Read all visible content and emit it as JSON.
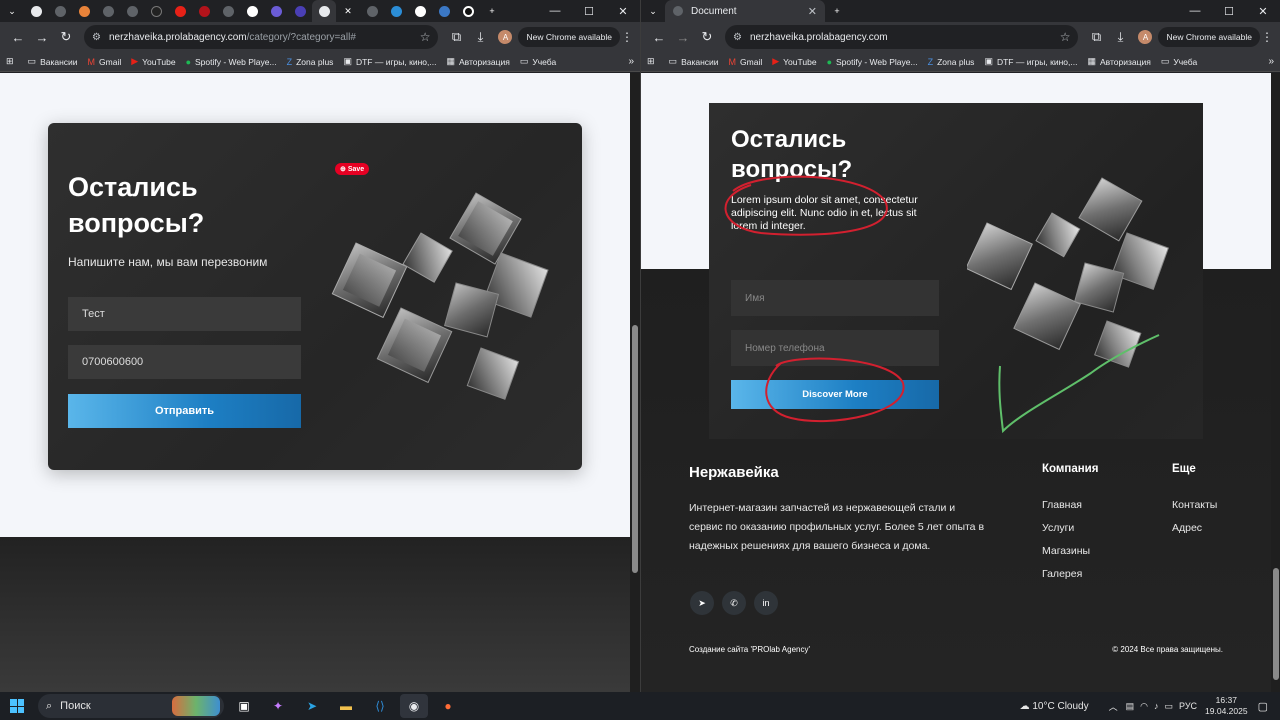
{
  "left_window": {
    "url_host": "nerzhaveika.prolabagency.com",
    "url_path": "/category/?category=all#",
    "new_chrome": "New Chrome available",
    "bookmarks": [
      "Вакансии",
      "Gmail",
      "YouTube",
      "Spotify - Web Playe...",
      "Zona plus",
      "DTF — игры, кино,...",
      "Авторизация",
      "Учеба"
    ],
    "form": {
      "title_line1": "Остались",
      "title_line2": "вопросы?",
      "subtitle": "Напишите нам, мы вам перезвоним",
      "name_value": "Тест",
      "phone_value": "0700600600",
      "submit_label": "Отправить",
      "pin_save": "Save"
    }
  },
  "right_window": {
    "tab_title": "Document",
    "url_host": "nerzhaveika.prolabagency.com",
    "new_chrome": "New Chrome available",
    "bookmarks": [
      "Вакансии",
      "Gmail",
      "YouTube",
      "Spotify - Web Playe...",
      "Zona plus",
      "DTF — игры, кино,...",
      "Авторизация",
      "Учеба"
    ],
    "form": {
      "title_line1": "Остались",
      "title_line2": "вопросы?",
      "lorem": "Lorem ipsum dolor sit amet, consectetur adipiscing elit. Nunc odio in et, lectus sit lorem id integer.",
      "name_placeholder": "Имя",
      "phone_placeholder": "Номер телефона",
      "submit_label": "Discover More"
    },
    "footer": {
      "brand": "Нержавейка",
      "description": "Интернет-магазин запчастей из нержавеющей стали и сервис по оказанию профильных услуг. Более 5 лет опыта в надежных решениях для вашего бизнеса и дома.",
      "col1_title": "Компания",
      "col1_links": [
        "Главная",
        "Услуги",
        "Магазины",
        "Галерея"
      ],
      "col2_title": "Еще",
      "col2_links": [
        "Контакты",
        "Адрес"
      ],
      "credit": "Создание сайта 'PROlab Agency'",
      "copyright": "© 2024 Все права защищены."
    }
  },
  "taskbar": {
    "search": "Поиск",
    "weather": "10°C  Cloudy",
    "lang": "РУС",
    "time": "16:37",
    "date": "19.04.2025"
  },
  "colors": {
    "accent_blue": "#1d7fc4",
    "annotation_red": "#d2202f",
    "annotation_green": "#5fbf6a"
  }
}
